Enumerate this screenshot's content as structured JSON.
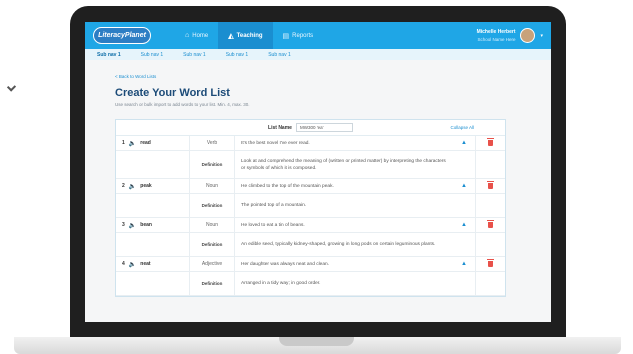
{
  "brand": {
    "logo_text": "LiteracyPlanet"
  },
  "nav": {
    "items": [
      {
        "label": "Home",
        "icon": "home-icon",
        "glyph": "⌂",
        "active": false
      },
      {
        "label": "Teaching",
        "icon": "graduation-cap-icon",
        "glyph": "◭",
        "active": true
      },
      {
        "label": "Reports",
        "icon": "report-icon",
        "glyph": "▤",
        "active": false
      }
    ]
  },
  "user": {
    "name": "Michelle Herbert",
    "school": "School Name Here"
  },
  "subnav": {
    "items": [
      "Sub nav 1",
      "Sub nav 1",
      "Sub nav 1",
      "Sub nav 1",
      "Sub nav 1"
    ]
  },
  "page": {
    "back_link": "< Back to Word Lists",
    "title": "Create Your Word List",
    "subtitle": "Use search or bulk import to add words to your list. Min. 4, max. 30."
  },
  "list": {
    "name_label": "List Name",
    "name_value": "MW300 'ea'",
    "collapse_label": "Collapse All",
    "definition_label": "Definition",
    "entries": [
      {
        "num": "1",
        "word": "read",
        "pos": "Verb",
        "sentence": "It's the best novel I've ever read.",
        "definition": "Look at and comprehend the meaning of (written or printed matter) by interpreting the characters or symbols of which it is composed."
      },
      {
        "num": "2",
        "word": "peak",
        "pos": "Noun",
        "sentence": "He climbed to the top of the mountain peak.",
        "definition": "The pointed top of a mountain."
      },
      {
        "num": "3",
        "word": "bean",
        "pos": "Noun",
        "sentence": "He loved to eat a tin of beans.",
        "definition": "An edible seed, typically kidney-shaped, growing in long pods on certain leguminous plants."
      },
      {
        "num": "4",
        "word": "neat",
        "pos": "Adjective",
        "sentence": "Her daughter was always neat and clean.",
        "definition": "Arranged in a tidy way; in good order."
      }
    ]
  },
  "colors": {
    "nav_bg": "#1fa6e6",
    "title": "#1c4b78",
    "accent": "#1a8ed0",
    "delete": "#e8514a"
  }
}
